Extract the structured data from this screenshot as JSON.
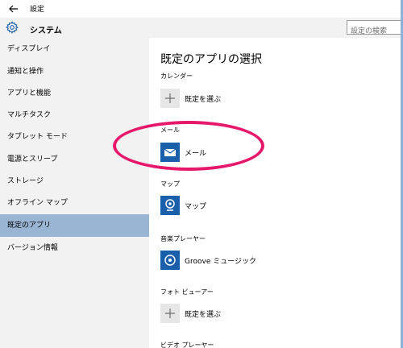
{
  "window": {
    "title": "設定"
  },
  "header": {
    "section_title": "システム",
    "search_placeholder": "設定の検索"
  },
  "sidebar": {
    "items": [
      {
        "label": "ディスプレイ"
      },
      {
        "label": "通知と操作"
      },
      {
        "label": "アプリと機能"
      },
      {
        "label": "マルチタスク"
      },
      {
        "label": "タブレット モード"
      },
      {
        "label": "電源とスリープ"
      },
      {
        "label": "ストレージ"
      },
      {
        "label": "オフライン マップ"
      },
      {
        "label": "既定のアプリ",
        "selected": true
      },
      {
        "label": "バージョン情報"
      }
    ]
  },
  "main": {
    "title": "既定のアプリの選択",
    "categories": [
      {
        "label": "カレンダー",
        "app": "既定を選ぶ",
        "icon": "plus-icon"
      },
      {
        "label": "メール",
        "app": "メール",
        "icon": "mail-icon"
      },
      {
        "label": "マップ",
        "app": "マップ",
        "icon": "maps-icon"
      },
      {
        "label": "音楽プレーヤー",
        "app": "Groove ミュージック",
        "icon": "groove-music-icon"
      },
      {
        "label": "フォト ビューアー",
        "app": "既定を選ぶ",
        "icon": "plus-icon"
      },
      {
        "label": "ビデオ プレーヤー"
      }
    ]
  },
  "colors": {
    "accent_tile": "#1a5faa",
    "selected_item": "#9ab5d4",
    "highlight_ellipse": "#e6186b",
    "sidebar_bg": "#f2f2f2"
  }
}
